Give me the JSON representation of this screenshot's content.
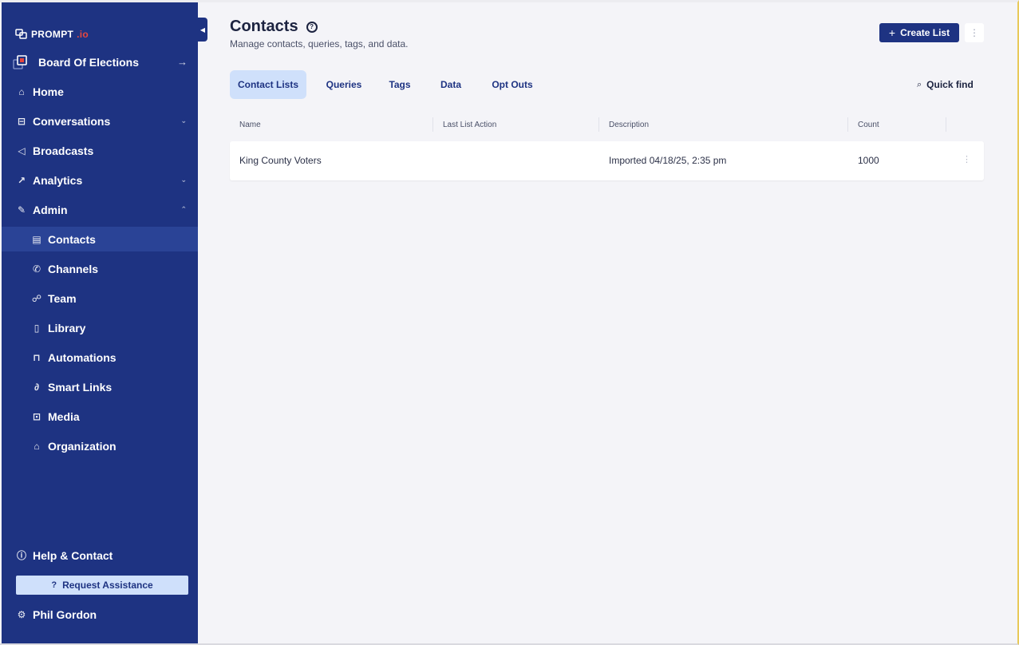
{
  "sidebar": {
    "logo": {
      "main": "PROMPT",
      "suffix": ".io"
    },
    "org": {
      "name": "Board Of Elections"
    },
    "items": [
      {
        "label": "Home",
        "icon": "home-icon"
      },
      {
        "label": "Conversations",
        "icon": "inbox-icon"
      },
      {
        "label": "Broadcasts",
        "icon": "megaphone-icon"
      },
      {
        "label": "Analytics",
        "icon": "trend-icon"
      },
      {
        "label": "Admin",
        "icon": "wrench-icon"
      }
    ],
    "admin_items": [
      {
        "label": "Contacts",
        "icon": "contacts-icon"
      },
      {
        "label": "Channels",
        "icon": "phone-icon"
      },
      {
        "label": "Team",
        "icon": "team-icon"
      },
      {
        "label": "Library",
        "icon": "book-icon"
      },
      {
        "label": "Automations",
        "icon": "automation-icon"
      },
      {
        "label": "Smart Links",
        "icon": "link-icon"
      },
      {
        "label": "Media",
        "icon": "media-icon"
      },
      {
        "label": "Organization",
        "icon": "bank-icon"
      }
    ],
    "help_label": "Help & Contact",
    "assist_label": "Request Assistance",
    "user_name": "Phil Gordon"
  },
  "header": {
    "title": "Contacts",
    "subtitle": "Manage contacts, queries, tags, and data.",
    "create_label": "Create List"
  },
  "tabs": [
    "Contact Lists",
    "Queries",
    "Tags",
    "Data",
    "Opt Outs"
  ],
  "quick_find": "Quick find",
  "table": {
    "columns": [
      "Name",
      "Last List Action",
      "Description",
      "Count"
    ],
    "rows": [
      {
        "name": "King County Voters",
        "last_action": "",
        "description": "Imported 04/18/25, 2:35 pm",
        "count": "1000"
      }
    ]
  },
  "colors": {
    "sidebar_bg": "#1e3382",
    "accent": "#1e3382",
    "tab_active_bg": "#cfe0fb",
    "logo_accent": "#e8473e"
  }
}
